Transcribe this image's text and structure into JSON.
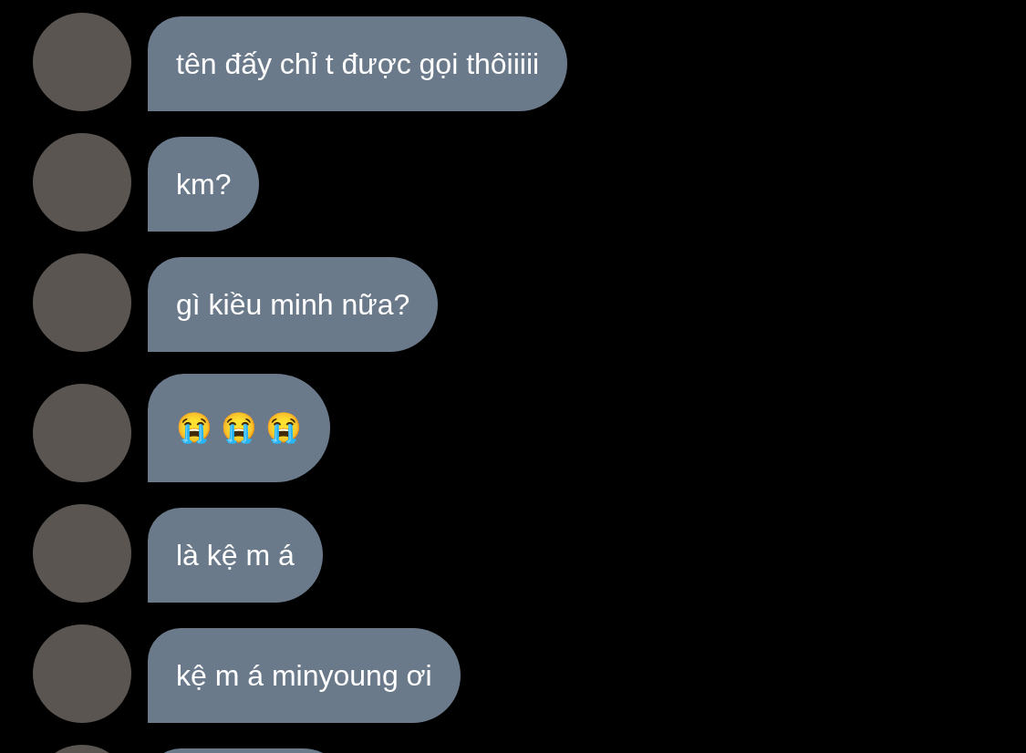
{
  "messages": [
    {
      "kind": "text",
      "text": "tên đấy chỉ t được gọi thôiiiii"
    },
    {
      "kind": "text",
      "text": "km?"
    },
    {
      "kind": "text",
      "text": "gì kiều minh nữa?"
    },
    {
      "kind": "emoji",
      "text": "😭 😭 😭"
    },
    {
      "kind": "text",
      "text": "là kệ m á"
    },
    {
      "kind": "text",
      "text": "kệ m á minyoung ơi"
    },
    {
      "kind": "cut_off"
    }
  ]
}
